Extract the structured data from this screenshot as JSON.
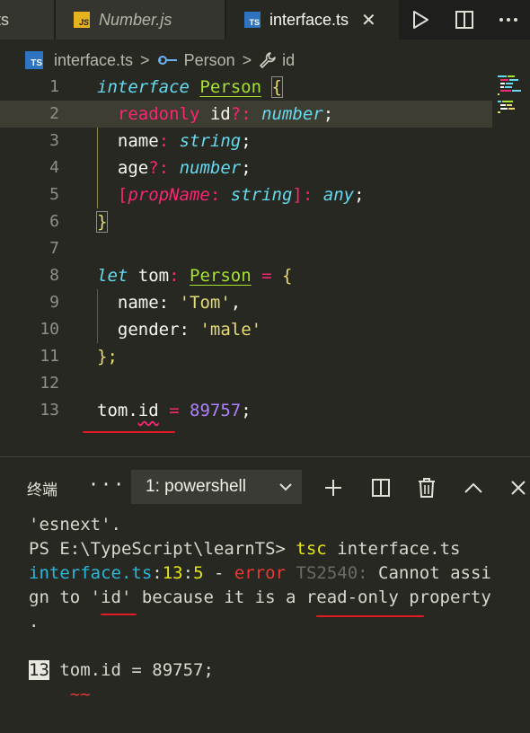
{
  "tabs": [
    {
      "label": "ts",
      "icon": "ts-file-icon"
    },
    {
      "label": "Number.js",
      "icon": "js-file-icon",
      "badge": "JS"
    },
    {
      "label": "interface.ts",
      "icon": "ts-file-icon",
      "badge": "TS",
      "active": true
    }
  ],
  "breadcrumb": {
    "file": "interface.ts",
    "badge": "TS",
    "symbol1": "Person",
    "symbol2": "id",
    "sep": ">"
  },
  "editor": {
    "line_numbers": [
      "1",
      "2",
      "3",
      "4",
      "5",
      "6",
      "7",
      "8",
      "9",
      "10",
      "11",
      "12",
      "13"
    ],
    "code": {
      "l1_kw": "interface",
      "l1_name": "Person",
      "l1_brace": "{",
      "l2_kw": "readonly",
      "l2_prop": "id",
      "l2_opt": "?",
      "l2_colon": ":",
      "l2_type": "number",
      "l2_semi": ";",
      "l3_prop": "name",
      "l3_colon": ":",
      "l3_type": "string",
      "l3_semi": ";",
      "l4_prop": "age",
      "l4_opt": "?",
      "l4_colon": ":",
      "l4_type": "number",
      "l4_semi": ";",
      "l5_open": "[",
      "l5_param": "propName",
      "l5_colon1": ":",
      "l5_type1": "string",
      "l5_close": "]",
      "l5_colon2": ":",
      "l5_type2": "any",
      "l5_semi": ";",
      "l6_brace": "}",
      "l8_kw": "let",
      "l8_var": "tom",
      "l8_colon": ":",
      "l8_type": "Person",
      "l8_eq": "=",
      "l8_brace": "{",
      "l9_prop": "name",
      "l9_colon": ":",
      "l9_str": "'Tom'",
      "l9_comma": ",",
      "l10_prop": "gender",
      "l10_colon": ":",
      "l10_str": "'male'",
      "l11_close": "};",
      "l13_obj": "tom",
      "l13_dot": ".",
      "l13_prop": "id",
      "l13_eq": "=",
      "l13_num": "89757",
      "l13_semi": ";"
    }
  },
  "terminal": {
    "title": "终端",
    "more": "···",
    "shell": "1: powershell",
    "lines": {
      "l1": "'esnext'.",
      "l2_prompt": "PS E:\\TypeScript\\learnTS> ",
      "l2_cmd": "tsc",
      "l2_arg": " interface.ts",
      "l3_file": "interface.ts",
      "l3_colon1": ":",
      "l3_line": "13",
      "l3_colon2": ":",
      "l3_col": "5",
      "l3_dash": " - ",
      "l3_err": "error",
      "l3_code": " TS2540:",
      "l3_msg": " Cannot assi",
      "l4_msg": "gn to 'id' because it is a read-only property",
      "l5": ".",
      "l7_num": "13",
      "l7_code": " tom.id = 89757;",
      "l8_squig": "~~"
    }
  },
  "colors": {
    "background": "#272822",
    "keyword": "#66d9ef",
    "string": "#e6db74",
    "number": "#ae81ff",
    "error": "#e53935",
    "annotation": "#e01b24"
  }
}
